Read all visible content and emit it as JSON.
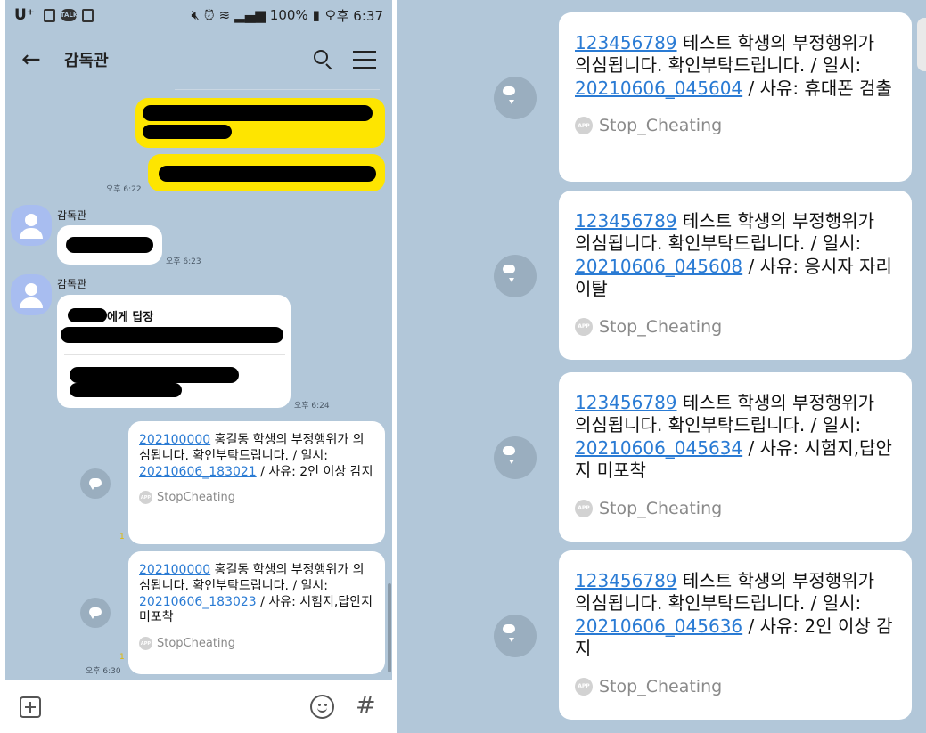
{
  "status_bar": {
    "carrier": "U⁺",
    "battery": "100%",
    "time": "오후 6:37",
    "icons": [
      "n-icon",
      "talk-icon",
      "gallery-icon",
      "mute-icon",
      "alarm-icon",
      "wifi-icon",
      "signal-icon",
      "battery-icon"
    ]
  },
  "header": {
    "title": "감독관"
  },
  "timestamps": {
    "my_messages": "오후 6:22",
    "msg1": "오후 6:23",
    "msg2": "오후 6:24",
    "msg4": "오후 6:30"
  },
  "senders": {
    "proctor": "감독관"
  },
  "reply": {
    "title_suffix": "에게 답장"
  },
  "unread_counts": {
    "msg3": "1",
    "msg4": "1"
  },
  "left_messages": [
    {
      "id_link": "202100000",
      "text_1": " 홍길동 학생의 부정행위가 의심됩니다. 확인부탁드립니다. / 일시: ",
      "date_link": "20210606_183021",
      "text_2": " / 사유: 2인 이상 감지",
      "app": "StopCheating"
    },
    {
      "id_link": "202100000",
      "text_1": " 홍길동 학생의 부정행위가 의심됩니다. 확인부탁드립니다. / 일시: ",
      "date_link": "20210606_183023",
      "text_2": " / 사유: 시험지,답안지 미포착",
      "app": "StopCheating"
    }
  ],
  "right_messages": [
    {
      "id_link": "123456789",
      "text_1": " 테스트 학생의 부정행위가 의심됩니다. 확인부탁드립니다. / 일시: ",
      "date_link": "20210606_045604",
      "text_2": " / 사유: 휴대폰 검출",
      "app": "Stop_Cheating"
    },
    {
      "id_link": "123456789",
      "text_1": " 테스트 학생의 부정행위가 의심됩니다. 확인부탁드립니다. / 일시: ",
      "date_link": "20210606_045608",
      "text_2": " / 사유: 응시자 자리이탈",
      "app": "Stop_Cheating"
    },
    {
      "id_link": "123456789",
      "text_1": " 테스트 학생의 부정행위가 의심됩니다. 확인부탁드립니다. / 일시: ",
      "date_link": "20210606_045634",
      "text_2": " / 사유: 시험지,답안지 미포착",
      "app": "Stop_Cheating"
    },
    {
      "id_link": "123456789",
      "text_1": " 테스트 학생의 부정행위가 의심됩니다. 확인부탁드립니다. / 일시: ",
      "date_link": "20210606_045636",
      "text_2": " / 사유: 2인 이상 감지",
      "app": "Stop_Cheating"
    }
  ],
  "app_badge_label": "APP",
  "colors": {
    "chat_background": "#b2c7d9",
    "my_bubble": "#fee500",
    "link": "#2a7bd4",
    "redaction": "#000000"
  }
}
